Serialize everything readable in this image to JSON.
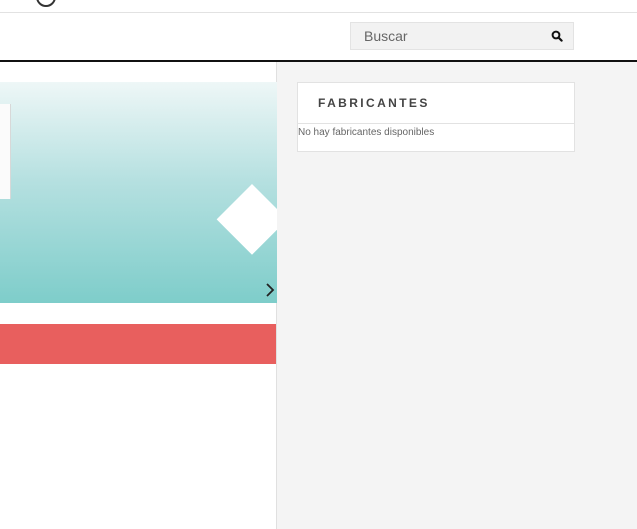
{
  "search": {
    "placeholder": "Buscar",
    "icon": "search-icon"
  },
  "slider": {
    "next_icon": "chevron-right-icon"
  },
  "manufacturers_block": {
    "title": "FABRICANTES",
    "empty_message": "No hay fabricantes disponibles"
  },
  "colors": {
    "slider_gradient_top": "#eef7f7",
    "slider_gradient_bottom": "#7ecdca",
    "banner_red": "#e85f5e",
    "page_background": "#f4f4f4"
  }
}
